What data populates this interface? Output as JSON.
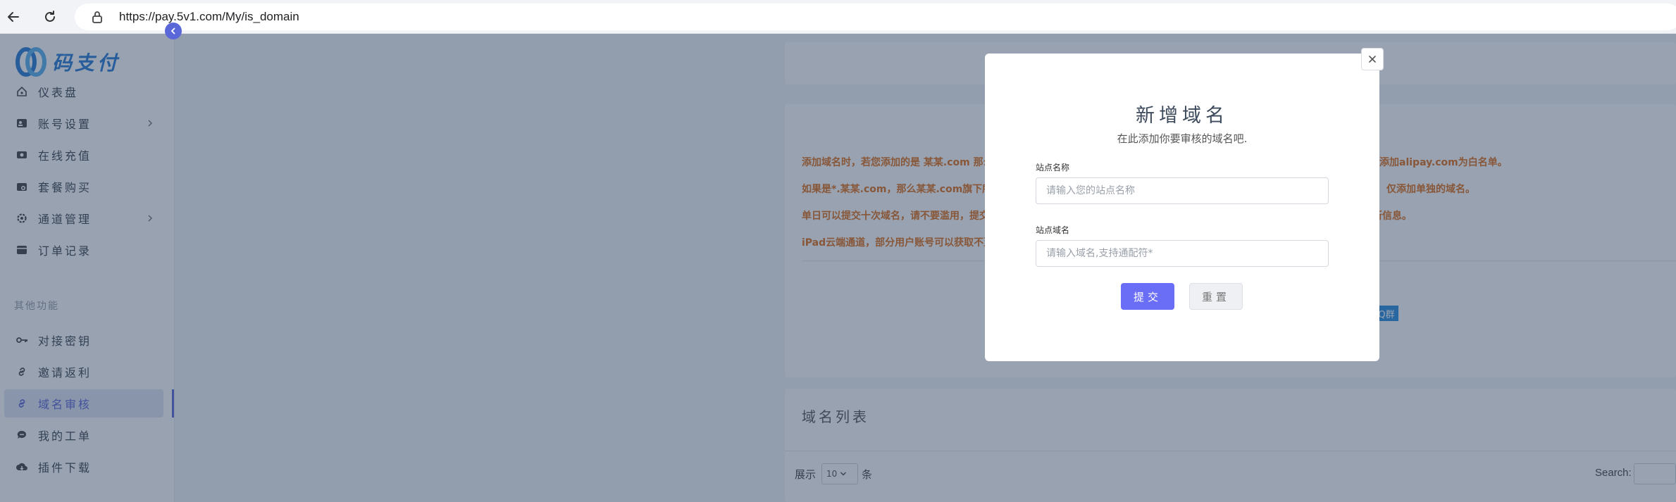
{
  "browser": {
    "url": "https://pay.5v1.com/My/is_domain"
  },
  "sidebar": {
    "logo_text": "码支付",
    "items": [
      {
        "label": "仪表盘",
        "icon": "home-icon"
      },
      {
        "label": "账号设置",
        "icon": "id-card-icon",
        "has_submenu": true
      },
      {
        "label": "在线充值",
        "icon": "recharge-icon"
      },
      {
        "label": "套餐购买",
        "icon": "package-icon"
      },
      {
        "label": "通道管理",
        "icon": "gear-icon",
        "has_submenu": true
      },
      {
        "label": "订单记录",
        "icon": "order-icon"
      }
    ],
    "section_label": "其他功能",
    "items2": [
      {
        "label": "对接密钥",
        "icon": "key-icon"
      },
      {
        "label": "邀请返利",
        "icon": "link-icon"
      },
      {
        "label": "域名审核",
        "icon": "link-icon",
        "active": true
      },
      {
        "label": "我的工单",
        "icon": "chat-icon"
      },
      {
        "label": "插件下载",
        "icon": "cloud-download-icon"
      }
    ]
  },
  "main": {
    "notices": [
      "添加域名时，若您添加的是 某某.com 那么",
      "如果是*.某某.com，那么某某.com旗下所",
      "单日可以提交十次域名，请不要滥用，提交",
      "iPad云端通道，部分用户账号可以获取不至"
    ],
    "notices_right": [
      "添加alipay.com为白名单。",
      "仅添加单独的域名。",
      "所信息。"
    ],
    "qq_badge": "Q群",
    "list_title": "域名列表",
    "show_label": "展示",
    "page_length": "10",
    "unit_label": "条",
    "search_label": "Search:"
  },
  "modal": {
    "title": "新增域名",
    "subtitle": "在此添加你要审核的域名吧.",
    "site_name_label": "站点名称",
    "site_name_placeholder": "请输入您的站点名称",
    "site_domain_label": "站点域名",
    "site_domain_placeholder": "请输入域名,支持通配符*",
    "submit_label": "提交",
    "reset_label": "重置"
  },
  "colors": {
    "accent": "#5a67d8",
    "submit": "#6a6df5",
    "notice": "#e0701c",
    "qq_badge": "#2a8ce0"
  }
}
